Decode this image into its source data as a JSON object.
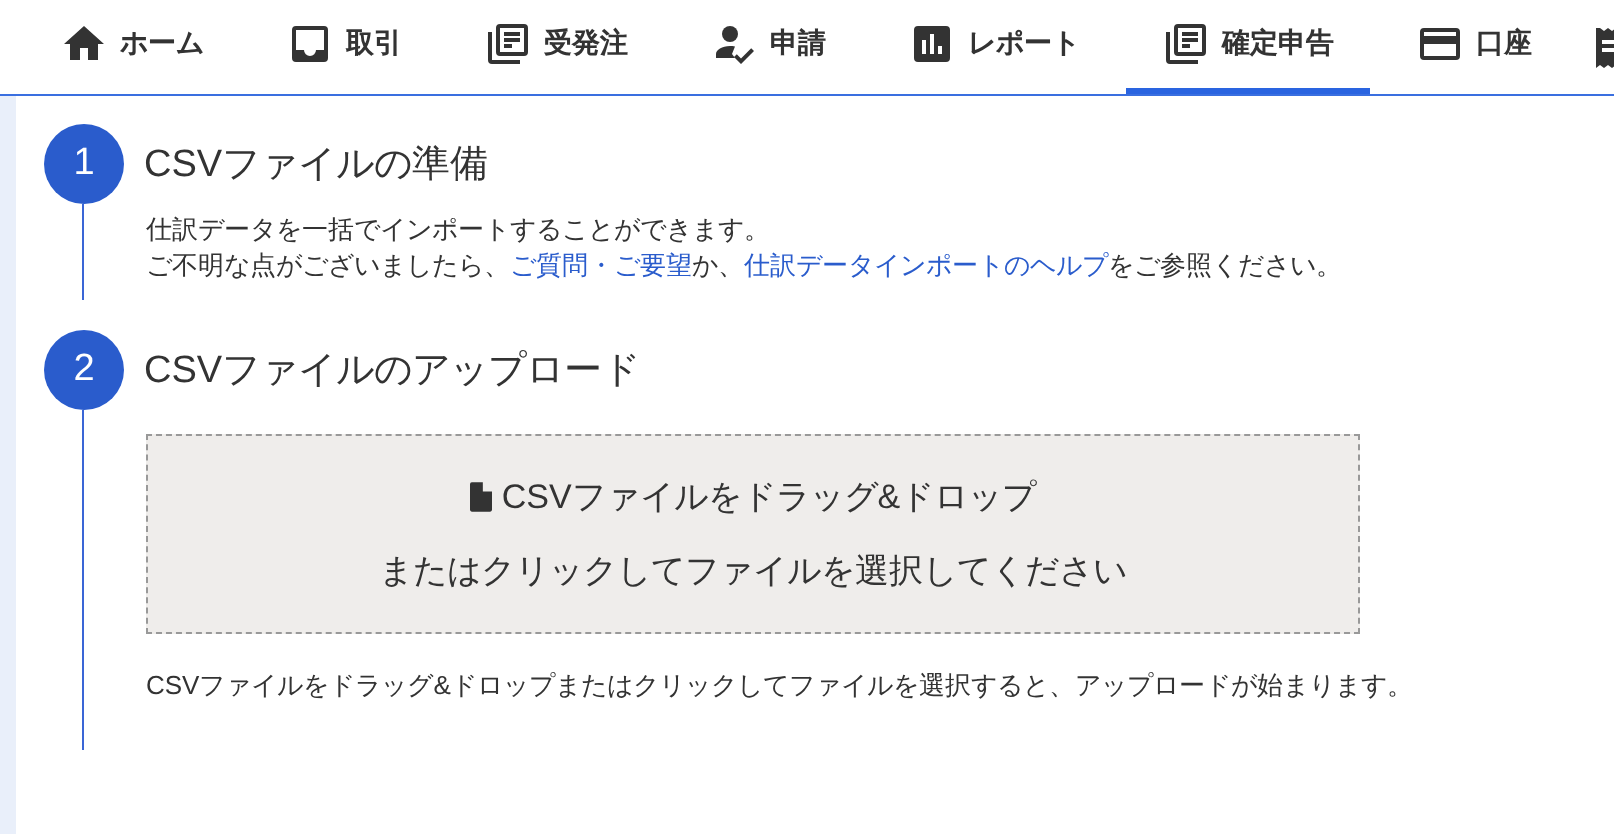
{
  "tabs": [
    {
      "label": "ホーム",
      "selected": false
    },
    {
      "label": "取引",
      "selected": false
    },
    {
      "label": "受発注",
      "selected": false
    },
    {
      "label": "申請",
      "selected": false
    },
    {
      "label": "レポート",
      "selected": false
    },
    {
      "label": "確定申告",
      "selected": true
    },
    {
      "label": "口座",
      "selected": false
    }
  ],
  "steps": [
    {
      "number": "1",
      "title": "CSVファイルの準備",
      "kind": "text",
      "lines": [
        [
          {
            "text": "仕訳データを一括でインポートすることができます。",
            "link": false
          }
        ],
        [
          {
            "text": "ご不明な点がございましたら、",
            "link": false
          },
          {
            "text": "ご質問・ご要望",
            "link": true
          },
          {
            "text": "か、",
            "link": false
          },
          {
            "text": "仕訳データインポートのヘルプ",
            "link": true
          },
          {
            "text": "をご参照ください。",
            "link": false
          }
        ]
      ]
    },
    {
      "number": "2",
      "title": "CSVファイルのアップロード",
      "kind": "upload",
      "dropzone": {
        "line1": "CSVファイルをドラッグ&ドロップ",
        "line2": "またはクリックしてファイルを選択してください"
      },
      "note": "CSVファイルをドラッグ&ドロップまたはクリックしてファイルを選択すると、アップロードが始まります。"
    }
  ]
}
